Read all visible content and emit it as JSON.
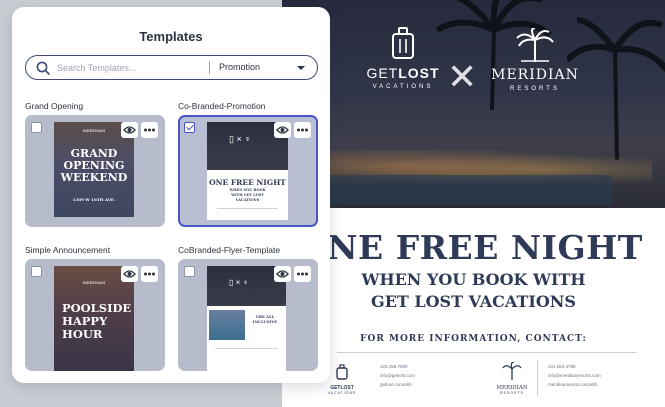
{
  "panel": {
    "title": "Templates",
    "search": {
      "placeholder": "Search Templates...",
      "value": ""
    },
    "filter": {
      "selected": "Promotion"
    },
    "templates": [
      {
        "label": "Grand Opening",
        "selected": false,
        "thumbnail": {
          "logo": "MERIDIAN",
          "headline": "GRAND OPENING WEEKEND",
          "detail": "1309 W 16TH AVE."
        }
      },
      {
        "label": "Co-Branded-Promotion",
        "selected": true,
        "thumbnail": {
          "headline": "ONE FREE NIGHT",
          "subline": "WHEN YOU BOOK WITH GET LOST VACATIONS"
        }
      },
      {
        "label": "Simple Announcement",
        "selected": false,
        "thumbnail": {
          "logo": "MERIDIAN",
          "headline": "POOLSIDE HAPPY HOUR"
        }
      },
      {
        "label": "CoBranded-Flyer-Template",
        "selected": false,
        "thumbnail": {
          "headline": "THE ALL INCLUSIVE"
        }
      }
    ]
  },
  "flyer": {
    "brand_left": {
      "name_light": "GET",
      "name_bold": "LOST",
      "sub": "VACATIONS"
    },
    "brand_right": {
      "name": "MERIDIAN",
      "sub": "RESORTS"
    },
    "headline": "ONE FREE NIGHT",
    "subheadline_1": "WHEN YOU BOOK WITH",
    "subheadline_2": "GET LOST VACATIONS",
    "info_heading": "FOR MORE INFORMATION, CONTACT:",
    "contact_left": {
      "brand": "GETLOST",
      "sub": "VACATIONS",
      "phone": "123.456.7890",
      "email": "info@getlost.com",
      "web": "getlost.com/ahh"
    },
    "contact_right": {
      "brand": "MERIDIAN",
      "sub": "RESORTS",
      "phone": "231.564.3798",
      "email": "info@meridianresorts.com",
      "web": "meridianresorts.com/ahh"
    }
  },
  "colors": {
    "accent": "#4a56c8",
    "navy": "#2f3a57",
    "card": "#b6bccb"
  }
}
